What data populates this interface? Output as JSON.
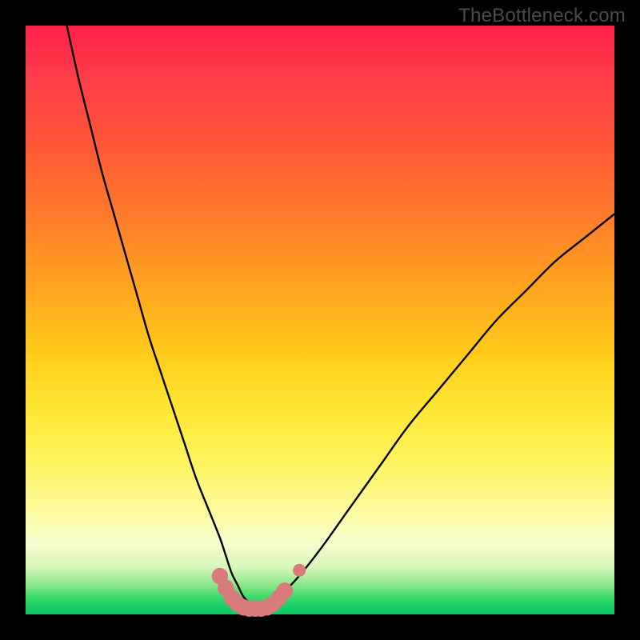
{
  "watermark": "TheBottleneck.com",
  "colors": {
    "frame": "#000000",
    "gradient_top": "#ff1f4a",
    "gradient_mid": "#ffe634",
    "gradient_bottom": "#0fc864",
    "curve": "#000000",
    "marker_fill": "#d97b7b",
    "marker_stroke": "#d97b7b"
  },
  "chart_data": {
    "type": "line",
    "title": "",
    "xlabel": "",
    "ylabel": "",
    "xlim": [
      0,
      100
    ],
    "ylim": [
      0,
      100
    ],
    "series": [
      {
        "name": "bottleneck-curve",
        "x": [
          7,
          9,
          11,
          13,
          15,
          17,
          19,
          21,
          23,
          25,
          27,
          29,
          31,
          33,
          34,
          35,
          36,
          37,
          38,
          39,
          40,
          41,
          42,
          43,
          46,
          50,
          55,
          60,
          65,
          70,
          75,
          80,
          85,
          90,
          95,
          100
        ],
        "y": [
          100,
          91,
          83,
          75,
          68,
          61,
          54,
          47,
          41,
          35,
          29,
          23,
          18,
          13,
          10,
          7,
          5,
          3,
          2,
          1,
          1,
          1,
          2,
          3,
          6,
          11,
          18,
          25,
          32,
          38,
          44,
          50,
          55,
          60,
          64,
          68
        ]
      }
    ],
    "markers": [
      {
        "x": 33.0,
        "y": 6.5,
        "r": 1.4
      },
      {
        "x": 34.0,
        "y": 4.5,
        "r": 1.4
      },
      {
        "x": 35.0,
        "y": 2.8,
        "r": 1.4
      },
      {
        "x": 36.0,
        "y": 1.8,
        "r": 1.4
      },
      {
        "x": 37.0,
        "y": 1.2,
        "r": 1.4
      },
      {
        "x": 38.0,
        "y": 1.0,
        "r": 1.4
      },
      {
        "x": 39.0,
        "y": 1.0,
        "r": 1.4
      },
      {
        "x": 40.0,
        "y": 1.0,
        "r": 1.4
      },
      {
        "x": 41.0,
        "y": 1.2,
        "r": 1.4
      },
      {
        "x": 42.0,
        "y": 1.8,
        "r": 1.4
      },
      {
        "x": 43.0,
        "y": 2.8,
        "r": 1.4
      },
      {
        "x": 44.0,
        "y": 4.0,
        "r": 1.4
      },
      {
        "x": 46.5,
        "y": 7.5,
        "r": 1.1
      }
    ]
  }
}
